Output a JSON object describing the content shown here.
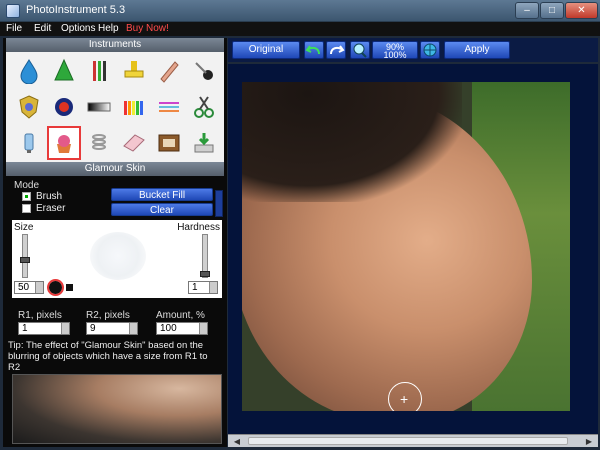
{
  "window": {
    "title": "PhotoInstrument 5.3",
    "minimize_glyph": "–",
    "maximize_glyph": "□",
    "close_glyph": "✕"
  },
  "menu": [
    "File",
    "Edit",
    "Options",
    "Help",
    "Buy Now!"
  ],
  "instruments": {
    "title": "Instruments",
    "tools": [
      "water-drop-icon",
      "green-cone-icon",
      "paintbrushes-icon",
      "yellow-stamp-icon",
      "eraser-stick-icon",
      "pin-icon",
      "shield-badge-icon",
      "red-eye-icon",
      "gradient-bar-icon",
      "color-pencils-icon",
      "lines-icon",
      "scissors-icon",
      "tube-icon",
      "cupcake-icon",
      "spring-icon",
      "pink-eraser-icon",
      "frame-icon",
      "download-disk-icon"
    ]
  },
  "glamour": {
    "title": "Glamour Skin",
    "mode_label": "Mode",
    "brush_label": "Brush",
    "eraser_label": "Eraser",
    "bucket_fill_label": "Bucket Fill",
    "clear_label": "Clear",
    "size_label": "Size",
    "hardness_label": "Hardness",
    "size_value": "50",
    "hardness_value": "1",
    "r1_label": "R1, pixels",
    "r2_label": "R2, pixels",
    "amount_label": "Amount, %",
    "r1_value": "1",
    "r2_value": "9",
    "amount_value": "100",
    "tip": "Tip: The effect of \"Glamour Skin\" based on the blurring of objects which have a size from R1 to R2"
  },
  "toolbar": {
    "original_label": "Original",
    "zoom_top": "90%",
    "zoom_bottom": "100%",
    "apply_label": "Apply"
  },
  "colors": {
    "accent_blue": "#1f48b6",
    "canvas_bg": "#04133a",
    "buy_now_red": "#ff4b4b",
    "selected_tool_outline": "#e83a3a"
  }
}
